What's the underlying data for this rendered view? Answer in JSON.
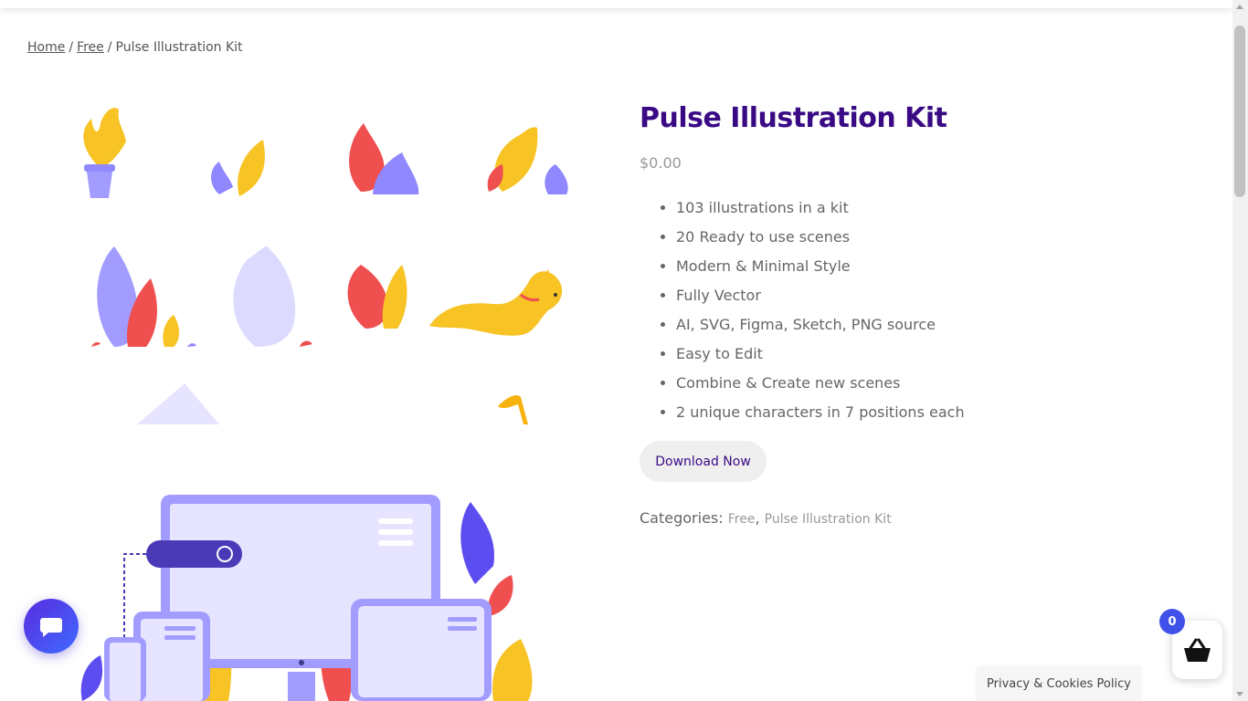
{
  "breadcrumb": {
    "home": "Home",
    "free": "Free",
    "current": "Pulse Illustration Kit",
    "separator": "/"
  },
  "product": {
    "title": "Pulse Illustration Kit",
    "price": "$0.00",
    "features": [
      "103 illustrations in a kit",
      "20 Ready to use scenes",
      "Modern & Minimal Style",
      "Fully Vector",
      "AI, SVG, Figma, Sketch, PNG source",
      "Easy to Edit",
      "Combine & Create new scenes",
      "2 unique characters in 7 positions each"
    ],
    "download_label": "Download Now",
    "categories_label": "Categories:",
    "categories": [
      "Free",
      "Pulse Illustration Kit"
    ],
    "categories_sep": ","
  },
  "cart": {
    "count": "0"
  },
  "footer": {
    "privacy_label": "Privacy & Cookies Policy"
  },
  "icons": {
    "chat": "chat-icon",
    "cart": "basket-icon"
  },
  "colors": {
    "title": "#3a0a85",
    "accent": "#3f51e8",
    "chat": "#5a2be0"
  }
}
